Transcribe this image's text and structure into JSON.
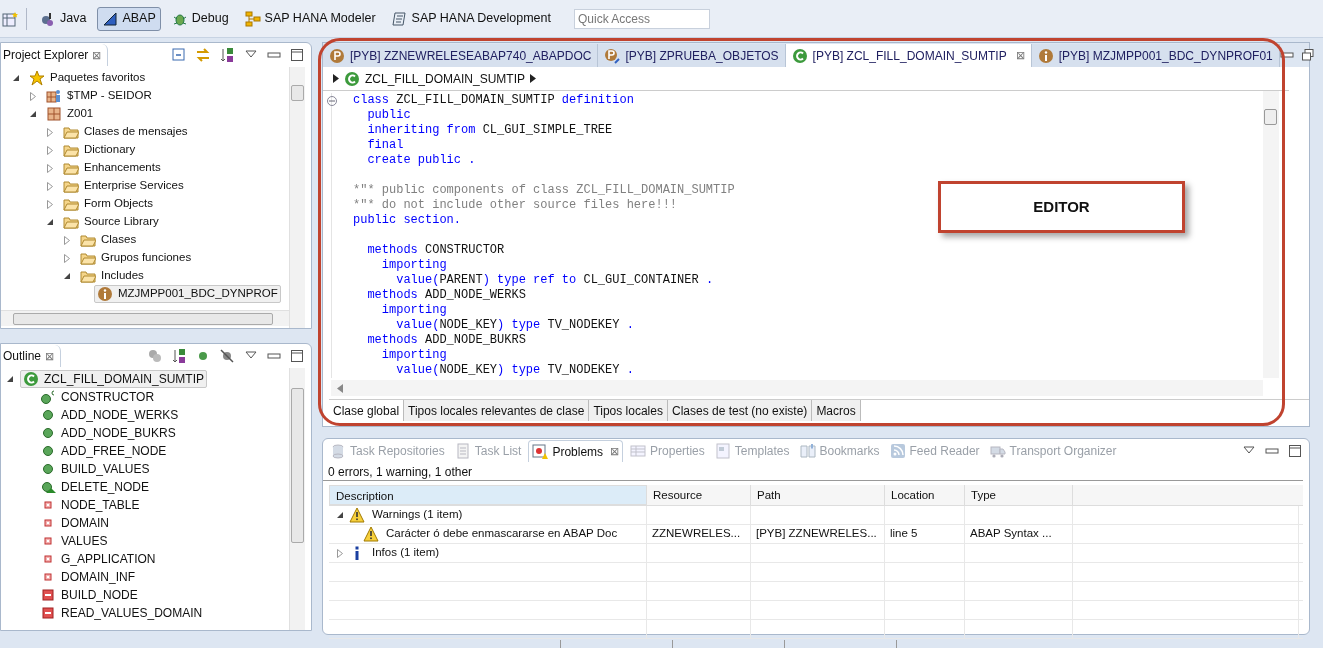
{
  "toolbar": {
    "perspectives": [
      {
        "label": "Java",
        "kind": "java",
        "selected": false
      },
      {
        "label": "ABAP",
        "kind": "abap",
        "selected": true
      },
      {
        "label": "Debug",
        "kind": "debug",
        "selected": false
      },
      {
        "label": "SAP HANA Modeler",
        "kind": "modeler",
        "selected": false
      },
      {
        "label": "SAP HANA Development",
        "kind": "development",
        "selected": false
      }
    ],
    "quick_access": {
      "placeholder": "Quick Access"
    }
  },
  "project_explorer": {
    "title": "Project Explorer",
    "close": "⊠",
    "tree": [
      {
        "label": "Paquetes favoritos",
        "kind": "star",
        "expanded": true,
        "selected": false,
        "children": [
          {
            "label": "$TMP - SEIDOR",
            "kind": "user-package",
            "expanded": false,
            "selected": false
          },
          {
            "label": "Z001",
            "kind": "package",
            "expanded": true,
            "selected": false,
            "children": [
              {
                "label": "Clases de mensajes",
                "kind": "folder",
                "expanded": false,
                "selected": false
              },
              {
                "label": "Dictionary",
                "kind": "folder",
                "expanded": false,
                "selected": false
              },
              {
                "label": "Enhancements",
                "kind": "folder",
                "expanded": false,
                "selected": false
              },
              {
                "label": "Enterprise Services",
                "kind": "folder",
                "expanded": false,
                "selected": false
              },
              {
                "label": "Form Objects",
                "kind": "folder",
                "expanded": false,
                "selected": false
              },
              {
                "label": "Source Library",
                "kind": "folder",
                "expanded": true,
                "selected": false,
                "children": [
                  {
                    "label": "Clases",
                    "kind": "folder",
                    "expanded": false,
                    "selected": false
                  },
                  {
                    "label": "Grupos funciones",
                    "kind": "folder",
                    "expanded": false,
                    "selected": false
                  },
                  {
                    "label": "Includes",
                    "kind": "folder",
                    "expanded": true,
                    "selected": false,
                    "children": [
                      {
                        "label": "MZJMPP001_BDC_DYNPROF",
                        "kind": "include",
                        "selected": true
                      }
                    ]
                  }
                ]
              }
            ]
          }
        ]
      }
    ]
  },
  "outline": {
    "title": "Outline",
    "close": "⊠",
    "tree": [
      {
        "label": "ZCL_FILL_DOMAIN_SUMTIP",
        "kind": "class",
        "expanded": true,
        "selected": true,
        "children": [
          {
            "label": "CONSTRUCTOR",
            "kind": "constructor",
            "selected": false
          },
          {
            "label": "ADD_NODE_WERKS",
            "kind": "method",
            "selected": false
          },
          {
            "label": "ADD_NODE_BUKRS",
            "kind": "method",
            "selected": false
          },
          {
            "label": "ADD_FREE_NODE",
            "kind": "method",
            "selected": false
          },
          {
            "label": "BUILD_VALUES",
            "kind": "method",
            "selected": false
          },
          {
            "label": "DELETE_NODE",
            "kind": "event",
            "selected": false
          },
          {
            "label": "NODE_TABLE",
            "kind": "attribute",
            "selected": false
          },
          {
            "label": "DOMAIN",
            "kind": "attribute",
            "selected": false
          },
          {
            "label": "VALUES",
            "kind": "attribute",
            "selected": false
          },
          {
            "label": "G_APPLICATION",
            "kind": "attribute",
            "selected": false
          },
          {
            "label": "DOMAIN_INF",
            "kind": "attribute",
            "selected": false
          },
          {
            "label": "BUILD_NODE",
            "kind": "private-method",
            "selected": false
          },
          {
            "label": "READ_VALUES_DOMAIN",
            "kind": "private-method",
            "selected": false
          }
        ]
      }
    ]
  },
  "editor": {
    "tabs": [
      {
        "label": "[PYB] ZZNEWRELESEABAP740_ABAPDOC",
        "kind": "program",
        "selected": false
      },
      {
        "label": "[PYB] ZPRUEBA_OBJETOS",
        "kind": "program-edit",
        "selected": false
      },
      {
        "label": "[PYB] ZCL_FILL_DOMAIN_SUMTIP",
        "kind": "class",
        "selected": true,
        "close": "⊠"
      },
      {
        "label": "[PYB] MZJMPP001_BDC_DYNPROF01",
        "kind": "include",
        "selected": false
      }
    ],
    "breadcrumb": "ZCL_FILL_DOMAIN_SUMTIP",
    "code": [
      {
        "kind": "code",
        "segments": [
          {
            "kind": "keyword",
            "text": "class "
          },
          {
            "kind": "plain",
            "text": "ZCL_FILL_DOMAIN_SUMTIP "
          },
          {
            "kind": "keyword",
            "text": "definition"
          }
        ]
      },
      {
        "kind": "code",
        "segments": [
          {
            "kind": "keyword",
            "text": "  public"
          }
        ]
      },
      {
        "kind": "code",
        "segments": [
          {
            "kind": "keyword",
            "text": "  inheriting from "
          },
          {
            "kind": "plain",
            "text": "CL_GUI_SIMPLE_TREE"
          }
        ]
      },
      {
        "kind": "code",
        "segments": [
          {
            "kind": "keyword",
            "text": "  final"
          }
        ]
      },
      {
        "kind": "code",
        "segments": [
          {
            "kind": "keyword",
            "text": "  create public ."
          }
        ]
      },
      {
        "kind": "blank"
      },
      {
        "kind": "code",
        "segments": [
          {
            "kind": "comment",
            "text": "*\"* public components of class ZCL_FILL_DOMAIN_SUMTIP"
          }
        ]
      },
      {
        "kind": "code",
        "segments": [
          {
            "kind": "comment",
            "text": "*\"* do not include other source files here!!!"
          }
        ]
      },
      {
        "kind": "code",
        "segments": [
          {
            "kind": "keyword",
            "text": "public section."
          }
        ]
      },
      {
        "kind": "blank"
      },
      {
        "kind": "code",
        "segments": [
          {
            "kind": "keyword",
            "text": "  methods "
          },
          {
            "kind": "plain",
            "text": "CONSTRUCTOR"
          }
        ]
      },
      {
        "kind": "code",
        "segments": [
          {
            "kind": "keyword",
            "text": "    importing"
          }
        ]
      },
      {
        "kind": "code",
        "segments": [
          {
            "kind": "keyword",
            "text": "      value("
          },
          {
            "kind": "plain",
            "text": "PARENT"
          },
          {
            "kind": "keyword",
            "text": ") type ref to "
          },
          {
            "kind": "plain",
            "text": "CL_GUI_CONTAINER "
          },
          {
            "kind": "keyword",
            "text": "."
          }
        ]
      },
      {
        "kind": "code",
        "segments": [
          {
            "kind": "keyword",
            "text": "  methods "
          },
          {
            "kind": "plain",
            "text": "ADD_NODE_WERKS"
          }
        ]
      },
      {
        "kind": "code",
        "segments": [
          {
            "kind": "keyword",
            "text": "    importing"
          }
        ]
      },
      {
        "kind": "code",
        "segments": [
          {
            "kind": "keyword",
            "text": "      value("
          },
          {
            "kind": "plain",
            "text": "NODE_KEY"
          },
          {
            "kind": "keyword",
            "text": ") type "
          },
          {
            "kind": "plain",
            "text": "TV_NODEKEY "
          },
          {
            "kind": "keyword",
            "text": "."
          }
        ]
      },
      {
        "kind": "code",
        "segments": [
          {
            "kind": "keyword",
            "text": "  methods "
          },
          {
            "kind": "plain",
            "text": "ADD_NODE_BUKRS"
          }
        ]
      },
      {
        "kind": "code",
        "segments": [
          {
            "kind": "keyword",
            "text": "    importing"
          }
        ]
      },
      {
        "kind": "code",
        "segments": [
          {
            "kind": "keyword",
            "text": "      value("
          },
          {
            "kind": "plain",
            "text": "NODE_KEY"
          },
          {
            "kind": "keyword",
            "text": ") type "
          },
          {
            "kind": "plain",
            "text": "TV_NODEKEY "
          },
          {
            "kind": "keyword",
            "text": "."
          }
        ]
      }
    ],
    "bottom_tabs": [
      {
        "label": "Clase global",
        "selected": true
      },
      {
        "label": "Tipos locales relevantes de clase",
        "selected": false
      },
      {
        "label": "Tipos locales",
        "selected": false
      },
      {
        "label": "Clases de test (no existe)",
        "selected": false
      },
      {
        "label": "Macros",
        "selected": false
      }
    ]
  },
  "annotation": {
    "label": "EDITOR"
  },
  "bottom_panel": {
    "tabs": [
      {
        "label": "Task Repositories",
        "kind": "repository",
        "selected": false
      },
      {
        "label": "Task List",
        "kind": "list",
        "selected": false
      },
      {
        "label": "Problems",
        "kind": "problems",
        "selected": true,
        "close": "⊠"
      },
      {
        "label": "Properties",
        "kind": "properties",
        "selected": false
      },
      {
        "label": "Templates",
        "kind": "templates",
        "selected": false
      },
      {
        "label": "Bookmarks",
        "kind": "bookmarks",
        "selected": false
      },
      {
        "label": "Feed Reader",
        "kind": "feed",
        "selected": false
      },
      {
        "label": "Transport Organizer",
        "kind": "transport",
        "selected": false
      }
    ],
    "summary": "0 errors, 1 warning, 1 other",
    "table": {
      "columns": [
        "Description",
        "Resource",
        "Path",
        "Location",
        "Type"
      ],
      "rows": [
        {
          "kind": "warning-group",
          "expanded": true,
          "cells": [
            "Warnings (1 item)"
          ]
        },
        {
          "kind": "warning-item",
          "cells": [
            "Carácter ó debe enmascararse en ABAP Doc",
            "ZZNEWRELES...",
            "[PYB] ZZNEWRELES...",
            "line 5",
            "ABAP Syntax ..."
          ]
        },
        {
          "kind": "info-group",
          "expanded": false,
          "cells": [
            "Infos (1 item)"
          ]
        }
      ]
    }
  }
}
